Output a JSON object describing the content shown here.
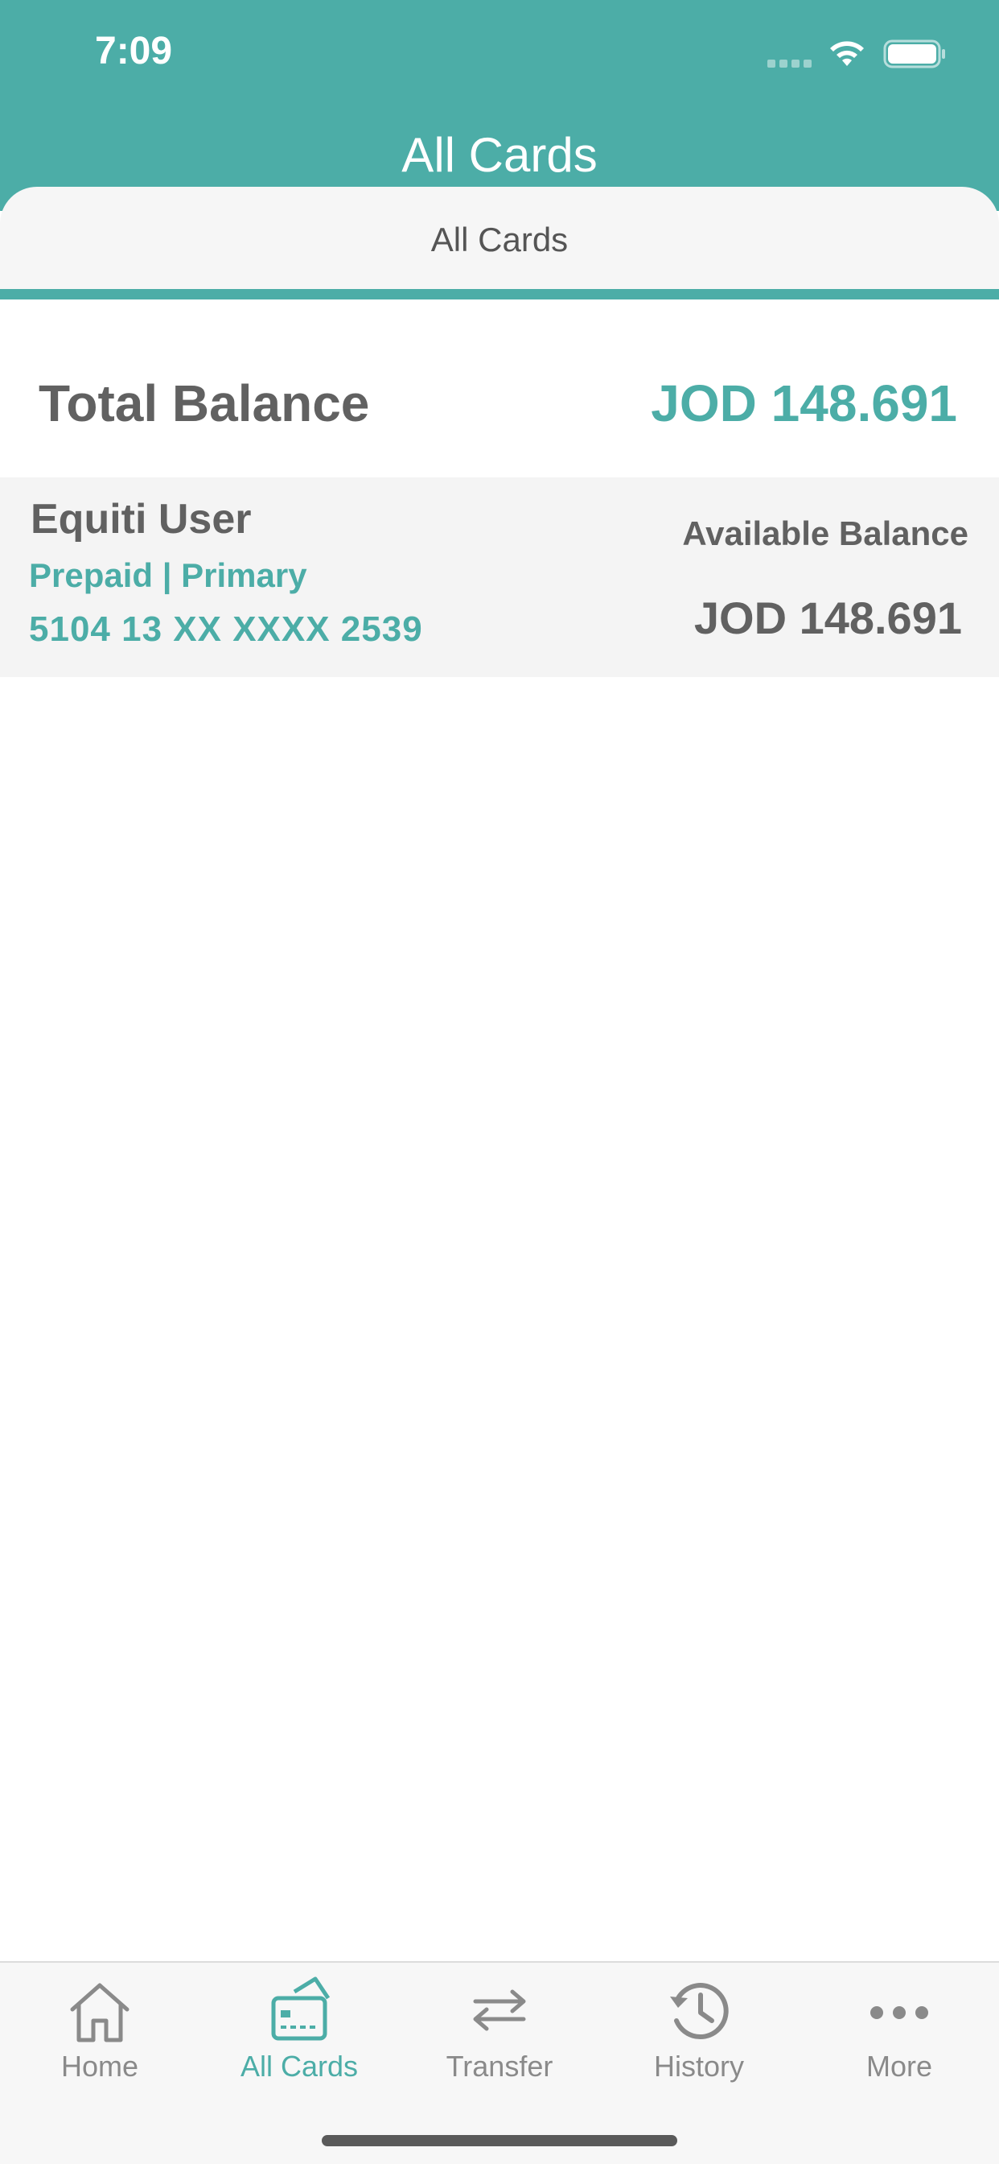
{
  "status_bar": {
    "time": "7:09"
  },
  "header": {
    "title": "All Cards"
  },
  "tab_strip": {
    "label": "All Cards"
  },
  "summary": {
    "total_label": "Total Balance",
    "total_value": "JOD 148.691"
  },
  "cards": [
    {
      "holder": "Equiti User",
      "type": "Prepaid | Primary",
      "number": "5104 13 XX XXXX 2539",
      "available_label": "Available Balance",
      "available_value": "JOD 148.691"
    }
  ],
  "tabbar": {
    "items": [
      {
        "label": "Home",
        "icon": "home-icon"
      },
      {
        "label": "All Cards",
        "icon": "card-icon",
        "active": true
      },
      {
        "label": "Transfer",
        "icon": "transfer-icon"
      },
      {
        "label": "History",
        "icon": "history-icon"
      },
      {
        "label": "More",
        "icon": "more-icon"
      }
    ]
  },
  "colors": {
    "accent": "#4cada7",
    "text_dark": "#616161",
    "inactive": "#8a8a8a"
  }
}
